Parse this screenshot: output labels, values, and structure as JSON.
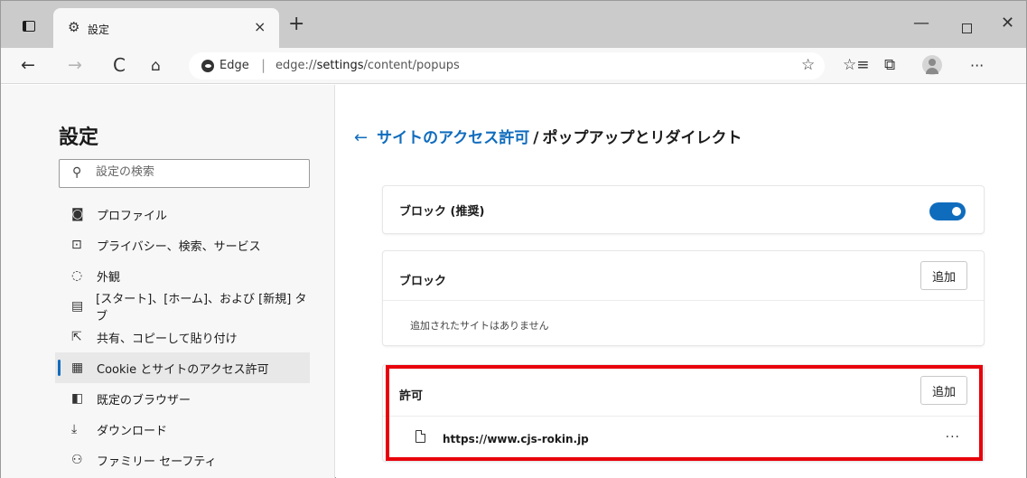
{
  "tab": {
    "title": "設定",
    "favicon": "gear-icon",
    "close": "×",
    "new_tab": "+"
  },
  "window_controls": {
    "minimize": "—",
    "close": "✕"
  },
  "toolbar": {
    "back": "←",
    "forward": "→",
    "refresh": "C",
    "home": "⌂",
    "address_label": "Edge",
    "address_separator": "|",
    "url_prefix": "edge://",
    "url_bold": "settings",
    "url_suffix": "/content/popups",
    "favorite_star": "☆",
    "favorites": "☆≡",
    "collections": "⧉",
    "more": "···"
  },
  "sidebar": {
    "title": "設定",
    "search": {
      "placeholder": "設定の検索",
      "icon": "search-icon"
    },
    "items": [
      {
        "label": "プロファイル",
        "icon": "◙",
        "name": "profile"
      },
      {
        "label": "プライバシー、検索、サービス",
        "icon": "🔒",
        "name": "privacy"
      },
      {
        "label": "外観",
        "icon": "◌",
        "name": "appearance"
      },
      {
        "label": "[スタート]、[ホーム]、および [新規] タブ",
        "icon": "▤",
        "name": "start-home"
      },
      {
        "label": "共有、コピーして貼り付け",
        "icon": "⇱",
        "name": "share-copy"
      },
      {
        "label": "Cookie とサイトのアクセス許可",
        "icon": "▦",
        "name": "cookies-permissions",
        "active": true
      },
      {
        "label": "既定のブラウザー",
        "icon": "◧",
        "name": "default-browser"
      },
      {
        "label": "ダウンロード",
        "icon": "⤓",
        "name": "downloads"
      },
      {
        "label": "ファミリー セーフティ",
        "icon": "⚇",
        "name": "family-safety"
      }
    ]
  },
  "main": {
    "breadcrumb": {
      "back": "←",
      "parent": "サイトのアクセス許可",
      "separator": "/",
      "current": "ポップアップとリダイレクト"
    },
    "block_toggle": {
      "label": "ブロック (推奨)",
      "enabled": true
    },
    "block_list": {
      "label": "ブロック",
      "add_label": "追加",
      "empty_text": "追加されたサイトはありません"
    },
    "allow_list": {
      "label": "許可",
      "add_label": "追加",
      "sites": [
        {
          "url": "https://www.cjs-rokin.jp",
          "more": "···"
        }
      ]
    }
  },
  "colors": {
    "accent": "#0f6cbd",
    "highlight": "#e8000b",
    "tabstrip": "#cbcbcb",
    "sidebar_bg": "#f7f7f7"
  }
}
